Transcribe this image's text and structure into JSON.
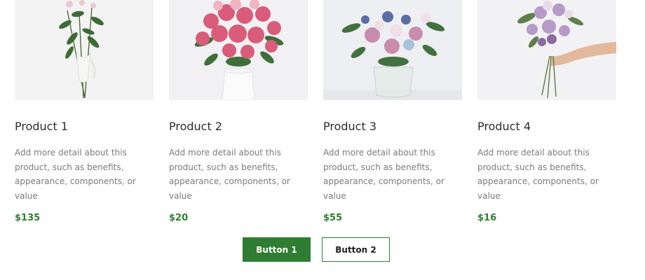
{
  "products": [
    {
      "title": "Product 1",
      "description": "Add more detail about this product, such as benefits, appearance, components, or value",
      "price": "$135"
    },
    {
      "title": "Product 2",
      "description": "Add more detail about this product, such as benefits, appearance, components, or value",
      "price": "$20"
    },
    {
      "title": "Product 3",
      "description": "Add more detail about this product, such as benefits, appearance, components, or value",
      "price": "$55"
    },
    {
      "title": "Product 4",
      "description": "Add more detail about this product, such as benefits, appearance, components, or value",
      "price": "$16"
    }
  ],
  "buttons": {
    "primary_label": "Button 1",
    "secondary_label": "Button 2"
  },
  "colors": {
    "accent": "#2e7d32",
    "price": "#2f7d32",
    "text": "#2d2d2d",
    "muted": "#7b7b7b"
  }
}
